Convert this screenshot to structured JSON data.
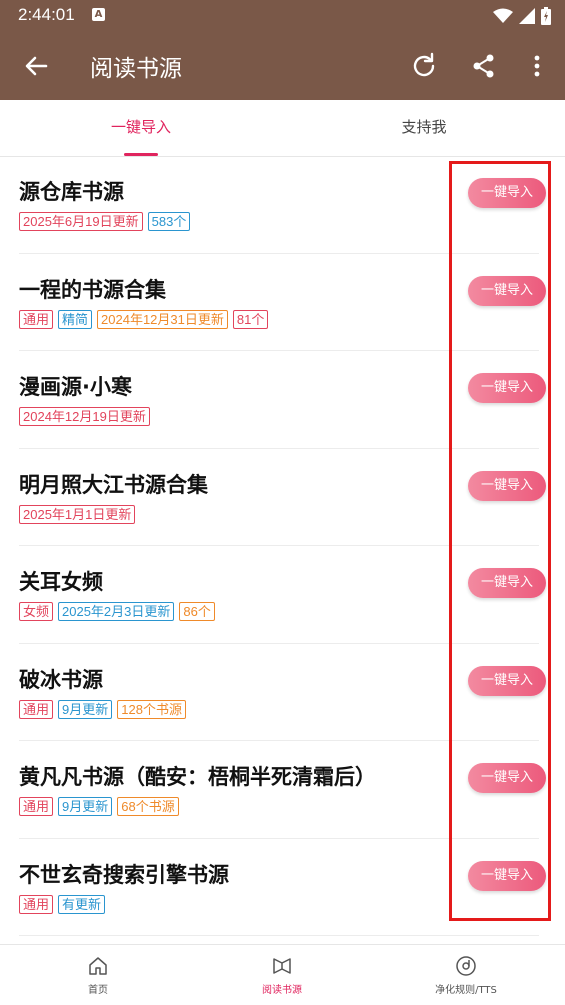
{
  "status_bar": {
    "time": "2:44:01",
    "notification_letter": "A"
  },
  "app_bar": {
    "title": "阅读书源"
  },
  "tabs": [
    {
      "label": "一键导入",
      "active": true
    },
    {
      "label": "支持我",
      "active": false
    }
  ],
  "import_label": "一键导入",
  "items": [
    {
      "title": "源仓库书源",
      "tags": [
        {
          "text": "2025年6月19日更新",
          "color": "red"
        },
        {
          "text": "583个",
          "color": "blue"
        }
      ]
    },
    {
      "title": "一程的书源合集",
      "tags": [
        {
          "text": "通用",
          "color": "red"
        },
        {
          "text": "精简",
          "color": "blue"
        },
        {
          "text": "2024年12月31日更新",
          "color": "orange"
        },
        {
          "text": "81个",
          "color": "red"
        }
      ]
    },
    {
      "title": "漫画源·小寒",
      "tags": [
        {
          "text": "2024年12月19日更新",
          "color": "red"
        }
      ]
    },
    {
      "title": "明月照大江书源合集",
      "tags": [
        {
          "text": "2025年1月1日更新",
          "color": "red"
        }
      ]
    },
    {
      "title": "关耳女频",
      "tags": [
        {
          "text": "女频",
          "color": "red"
        },
        {
          "text": "2025年2月3日更新",
          "color": "blue"
        },
        {
          "text": "86个",
          "color": "orange"
        }
      ]
    },
    {
      "title": "破冰书源",
      "tags": [
        {
          "text": "通用",
          "color": "red"
        },
        {
          "text": "9月更新",
          "color": "blue"
        },
        {
          "text": "128个书源",
          "color": "orange"
        }
      ]
    },
    {
      "title": "黄凡凡书源（酷安：梧桐半死清霜后）",
      "tags": [
        {
          "text": "通用",
          "color": "red"
        },
        {
          "text": "9月更新",
          "color": "blue"
        },
        {
          "text": "68个书源",
          "color": "orange"
        }
      ]
    },
    {
      "title": "不世玄奇搜索引擎书源",
      "tags": [
        {
          "text": "通用",
          "color": "red"
        },
        {
          "text": "有更新",
          "color": "blue"
        }
      ]
    }
  ],
  "bottom_nav": [
    {
      "label": "首页",
      "icon": "home-icon",
      "active": false
    },
    {
      "label": "阅读书源",
      "icon": "book-source-icon",
      "active": true
    },
    {
      "label": "净化规则/TTS",
      "icon": "disc-icon",
      "active": false
    }
  ],
  "colors": {
    "app_bar": "#7a5848",
    "accent": "#e0245e",
    "highlight_box": "#e41a1a"
  }
}
